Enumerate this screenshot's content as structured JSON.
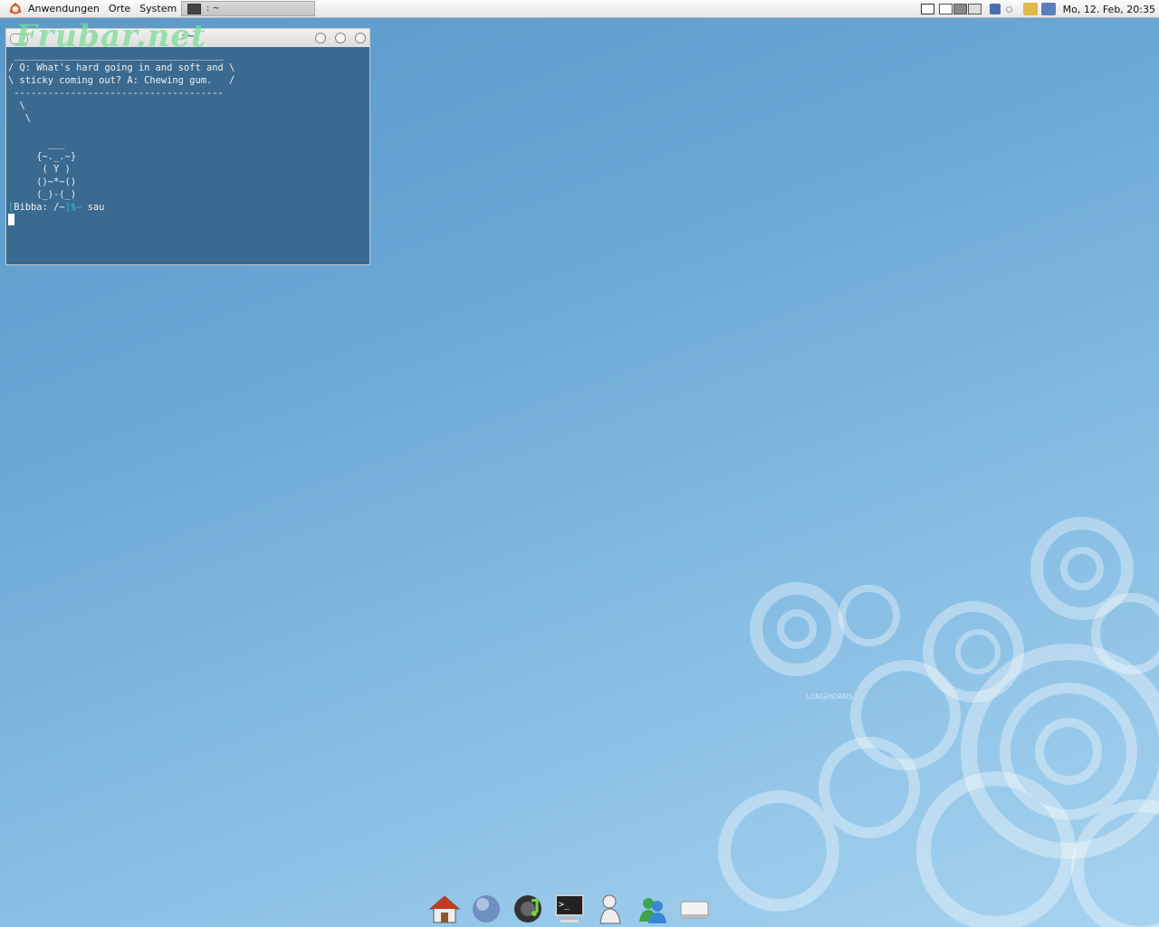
{
  "panel": {
    "menus": [
      "Anwendungen",
      "Orte",
      "System"
    ],
    "task_label": ": ~",
    "clock": "Mo, 12. Feb, 20:35"
  },
  "terminal": {
    "title": ": ~",
    "watermark": "Frubar.net",
    "fortune_top": " _____________________________________",
    "fortune_line1": "/ Q: What's hard going in and soft and \\",
    "fortune_line2": "\\ sticky coming out? A: Chewing gum.   /",
    "fortune_bottom": " -------------------------------------",
    "ascii": "  \\\n   \\\n\n       ___\n     {~._.~}\n      ( Y )\n     ()~*~()\n     (_)-(_)",
    "prompt_open": "[",
    "prompt_host": "Bibba: /~",
    "prompt_close": "]$~",
    "command": " sau"
  },
  "wallpaper": {
    "logo_text": "LONGHORNS"
  },
  "dock": {
    "icons": [
      "home-icon",
      "globe-icon",
      "music-icon",
      "terminal-icon",
      "user-icon",
      "messenger-icon",
      "drive-icon"
    ]
  },
  "colors": {
    "terminal_bg": "#3a6a90",
    "prompt_accent": "#29c3c3",
    "desktop": "#6aa9d6"
  }
}
